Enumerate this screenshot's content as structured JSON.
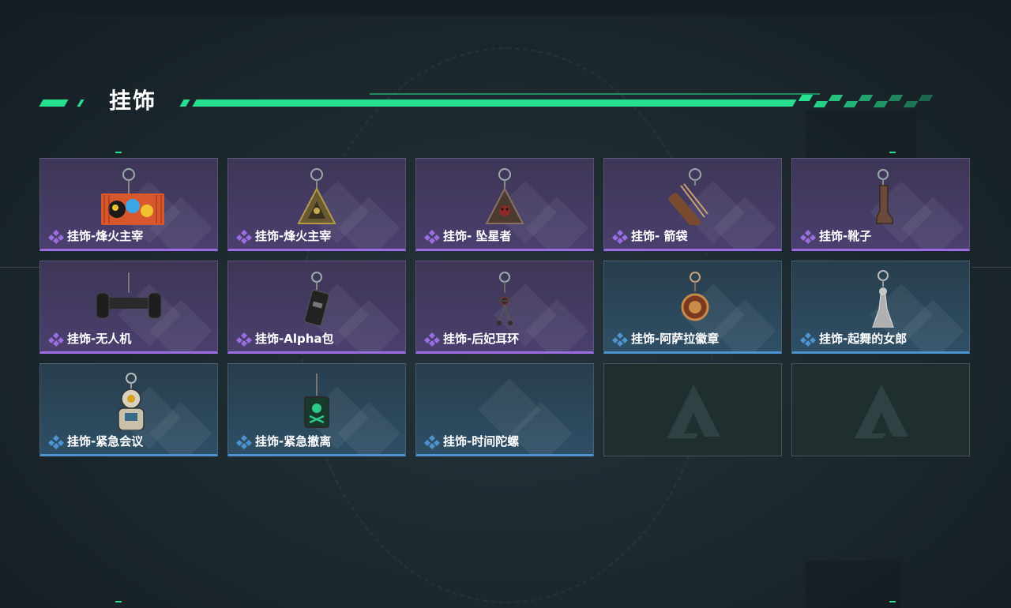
{
  "section": {
    "title": "挂饰"
  },
  "colors": {
    "accent": "#26e08f",
    "epic": "#9a6ee0",
    "rare": "#4c93cf"
  },
  "cards": [
    {
      "label": "挂饰-烽火主宰",
      "rarity": "epic",
      "icon": "graffiti-charm-icon"
    },
    {
      "label": "挂饰-烽火主宰",
      "rarity": "epic",
      "icon": "triangle-badge-charm-icon"
    },
    {
      "label": "挂饰- 坠星者",
      "rarity": "epic",
      "icon": "triangle-skull-charm-icon"
    },
    {
      "label": "挂饰- 箭袋",
      "rarity": "epic",
      "icon": "quiver-charm-icon"
    },
    {
      "label": "挂饰-靴子",
      "rarity": "epic",
      "icon": "boot-charm-icon"
    },
    {
      "label": "挂饰-无人机",
      "rarity": "epic",
      "icon": "drone-charm-icon"
    },
    {
      "label": "挂饰-Alpha包",
      "rarity": "epic",
      "icon": "alpha-pack-charm-icon"
    },
    {
      "label": "挂饰-后妃耳环",
      "rarity": "epic",
      "icon": "earring-charm-icon"
    },
    {
      "label": "挂饰-阿萨拉徽章",
      "rarity": "rare",
      "icon": "medal-charm-icon"
    },
    {
      "label": "挂饰-起舞的女郎",
      "rarity": "rare",
      "icon": "dancer-charm-icon"
    },
    {
      "label": "挂饰-紧急会议",
      "rarity": "rare",
      "icon": "meeting-charm-icon"
    },
    {
      "label": "挂饰-紧急撤离",
      "rarity": "rare",
      "icon": "evac-charm-icon"
    },
    {
      "label": "挂饰-时间陀螺",
      "rarity": "rare",
      "icon": ""
    },
    {
      "label": "",
      "rarity": "none",
      "icon": "empty-slot-logo-icon"
    },
    {
      "label": "",
      "rarity": "none",
      "icon": "empty-slot-logo-icon"
    }
  ]
}
